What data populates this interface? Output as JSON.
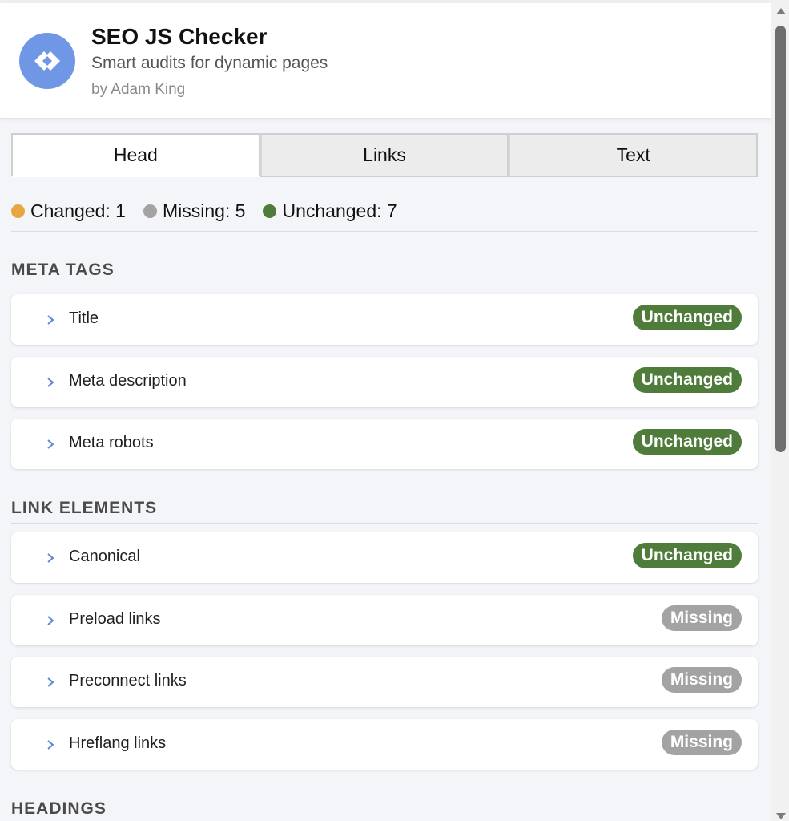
{
  "header": {
    "title": "SEO JS Checker",
    "subtitle": "Smart audits for dynamic pages",
    "author": "by Adam King",
    "logo_icon": "code-brackets-icon"
  },
  "tabs": [
    {
      "label": "Head",
      "active": true
    },
    {
      "label": "Links",
      "active": false
    },
    {
      "label": "Text",
      "active": false
    }
  ],
  "summary": {
    "changed": "Changed: 1",
    "missing": "Missing: 5",
    "unchanged": "Unchanged: 7"
  },
  "colors": {
    "changed": "#e8a640",
    "missing": "#a3a3a3",
    "unchanged": "#4f7c3a",
    "logo": "#6f97e6",
    "chevron": "#5b87d6"
  },
  "sections": {
    "meta_tags": {
      "title": "META TAGS",
      "items": [
        {
          "label": "Title",
          "status": "Unchanged"
        },
        {
          "label": "Meta description",
          "status": "Unchanged"
        },
        {
          "label": "Meta robots",
          "status": "Unchanged"
        }
      ]
    },
    "link_elements": {
      "title": "LINK ELEMENTS",
      "items": [
        {
          "label": "Canonical",
          "status": "Unchanged"
        },
        {
          "label": "Preload links",
          "status": "Missing"
        },
        {
          "label": "Preconnect links",
          "status": "Missing"
        },
        {
          "label": "Hreflang links",
          "status": "Missing"
        }
      ]
    },
    "headings": {
      "title": "HEADINGS"
    }
  }
}
